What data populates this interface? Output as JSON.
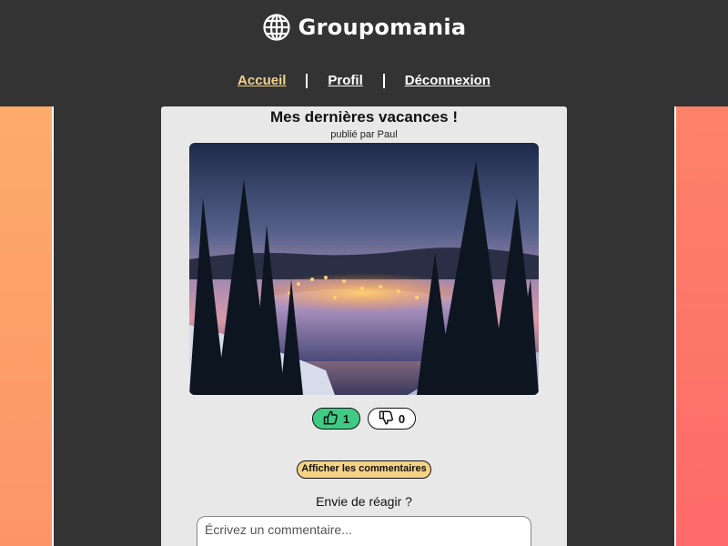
{
  "header": {
    "brand_name": "Groupomania",
    "logo_icon": "globe-icon",
    "nav": [
      {
        "label": "Accueil",
        "active": true
      },
      {
        "label": "Profil",
        "active": false
      },
      {
        "label": "Déconnexion",
        "active": false
      }
    ]
  },
  "post": {
    "title": "Mes dernières vacances !",
    "author_line": "publié par Paul",
    "image_description_icon": "winter-night-photo",
    "likes": "1",
    "dislikes": "0",
    "show_comments_label": "Afficher les commentaires",
    "react_prompt": "Envie de réagir ?",
    "comment_placeholder": "Écrivez un commentaire..."
  },
  "colors": {
    "background": "#333333",
    "active_nav": "#f2d28a",
    "like_green": "#3fca86",
    "comments_yellow": "#f5d285",
    "card": "#e8e8e8"
  }
}
